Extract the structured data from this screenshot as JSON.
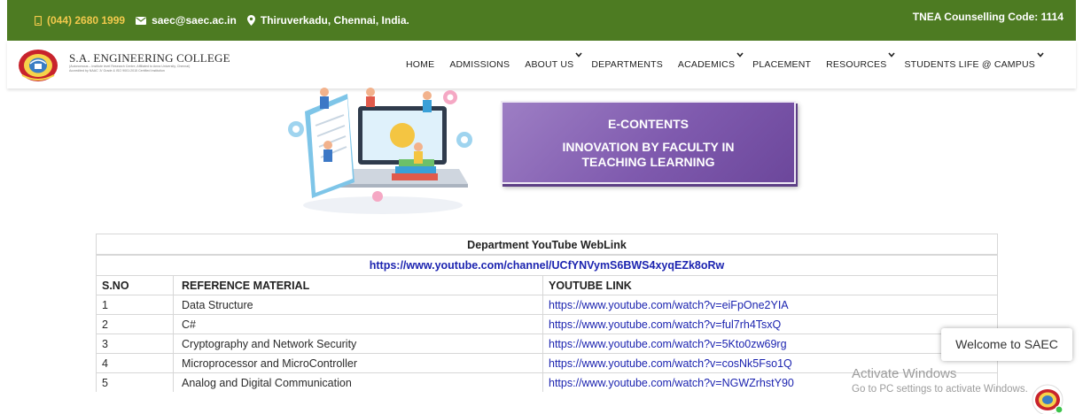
{
  "topbar": {
    "phone": "(044) 2680 1999",
    "email": "saec@saec.ac.in",
    "location": "Thiruverkadu, Chennai, India.",
    "tnea": "TNEA Counselling Code: 1114",
    "accent": "#4d7b22"
  },
  "header": {
    "college_name": "S.A. ENGINEERING COLLEGE",
    "college_sub_1": "(Autonomous – Institute level Research Centre, Affiliated to Anna University, Chennai)",
    "college_sub_2": "Accredited by NAAC 'A' Grade & ISO 9001:2015 Certified Institution"
  },
  "menu": {
    "home": "HOME",
    "admissions": "ADMISSIONS",
    "about": "ABOUT US",
    "departments": "DEPARTMENTS",
    "academics": "ACADEMICS",
    "placement": "PLACEMENT",
    "resources": "RESOURCES",
    "students_life": "STUDENTS LIFE @ CAMPUS"
  },
  "banner": {
    "title": "E-CONTENTS",
    "line1": "INNOVATION BY FACULTY IN",
    "line2": "TEACHING LEARNING",
    "color": "#7f5aae"
  },
  "table": {
    "title": "Department YouTube WebLink",
    "channel_link": "https://www.youtube.com/channel/UCfYNVymS6BWS4xyqEZk8oRw",
    "headers": {
      "sno": "S.NO",
      "material": "REFERENCE MATERIAL",
      "link": "YOUTUBE LINK"
    },
    "rows": [
      {
        "sno": "1",
        "material": "Data Structure",
        "link": "https://www.youtube.com/watch?v=eiFpOne2YIA"
      },
      {
        "sno": "2",
        "material": "C#",
        "link": "https://www.youtube.com/watch?v=ful7rh4TsxQ"
      },
      {
        "sno": "3",
        "material": "Cryptography and Network Security",
        "link": "https://www.youtube.com/watch?v=5Kto0zw69rg"
      },
      {
        "sno": "4",
        "material": "Microprocessor and MicroController",
        "link": "https://www.youtube.com/watch?v=cosNk5Fso1Q"
      },
      {
        "sno": "5",
        "material": "Analog and Digital Communication",
        "link": "https://www.youtube.com/watch?v=NGWZrhstY90"
      }
    ]
  },
  "chat": {
    "welcome": "Welcome to SAEC"
  },
  "activation": {
    "title": "Activate Windows",
    "subtitle": "Go to PC settings to activate Windows."
  }
}
